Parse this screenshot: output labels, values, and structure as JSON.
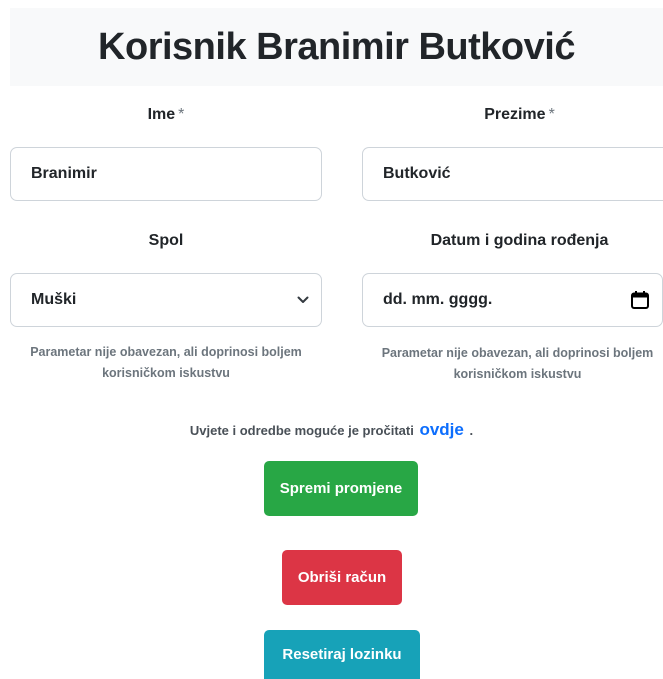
{
  "header": {
    "title": "Korisnik Branimir Butković"
  },
  "form": {
    "first_name": {
      "label": "Ime",
      "required_mark": "*",
      "value": "Branimir"
    },
    "last_name": {
      "label": "Prezime",
      "required_mark": "*",
      "value": "Butković"
    },
    "gender": {
      "label": "Spol",
      "selected": "Muški",
      "hint": "Parametar nije obavezan, ali doprinosi boljem korisničkom iskustvu"
    },
    "birth_date": {
      "label": "Datum i godina rođenja",
      "placeholder": "dd. mm. gggg.",
      "hint": "Parametar nije obavezan, ali doprinosi boljem korisničkom iskustvu"
    },
    "terms": {
      "text": "Uvjete i odredbe moguće je pročitati",
      "link": "ovdje",
      "suffix": "."
    }
  },
  "actions": {
    "save_label": "Spremi promjene",
    "delete_label": "Obriši račun",
    "reset_label": "Resetiraj lozinku"
  },
  "colors": {
    "save": "#28a745",
    "delete": "#dc3545",
    "reset": "#17a2b8",
    "link": "#0d6efd"
  },
  "icons": {
    "select": "chevron-down-icon",
    "date": "calendar-icon"
  }
}
